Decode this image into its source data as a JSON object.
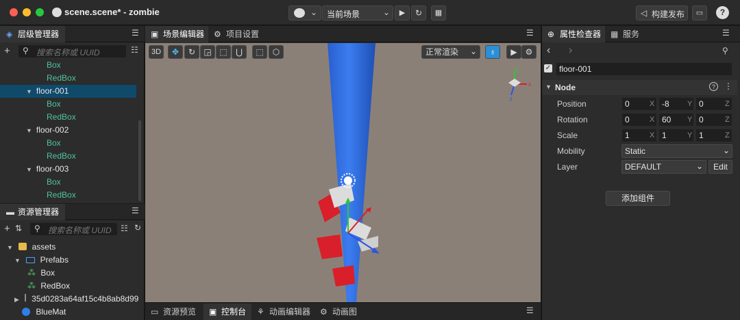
{
  "window": {
    "title": "scene.scene* - zombie"
  },
  "toolbar": {
    "scene_select": "当前场景",
    "build_label": "构建发布"
  },
  "hierarchy": {
    "tab": "层级管理器",
    "search_placeholder": "搜索名称或 UUID",
    "rows": [
      {
        "label": "Box",
        "kind": "child"
      },
      {
        "label": "RedBox",
        "kind": "child"
      },
      {
        "label": "floor-001",
        "kind": "parent",
        "selected": true
      },
      {
        "label": "Box",
        "kind": "child"
      },
      {
        "label": "RedBox",
        "kind": "child"
      },
      {
        "label": "floor-002",
        "kind": "parent"
      },
      {
        "label": "Box",
        "kind": "child"
      },
      {
        "label": "RedBox",
        "kind": "child"
      },
      {
        "label": "floor-003",
        "kind": "parent"
      },
      {
        "label": "Box",
        "kind": "child"
      },
      {
        "label": "RedBox",
        "kind": "child"
      }
    ]
  },
  "assets": {
    "tab": "资源管理器",
    "search_placeholder": "搜索名称或 UUID",
    "root": "assets",
    "prefabs": "Prefabs",
    "box": "Box",
    "redbox": "RedBox",
    "uuid_item": "35d0283a64af15c4b8ab8d99",
    "bluemat": "BlueMat"
  },
  "scene": {
    "tab_editor": "场景编辑器",
    "tab_settings": "项目设置",
    "mode_3d": "3D",
    "render_mode": "正常渲染"
  },
  "bottom_tabs": [
    "资源预览",
    "控制台",
    "动画编辑器",
    "动画图"
  ],
  "inspector": {
    "tab": "属性检查器",
    "tab_service": "服务",
    "node_name": "floor-001",
    "section": "Node",
    "position": {
      "label": "Position",
      "x": "0",
      "y": "-8",
      "z": "0"
    },
    "rotation": {
      "label": "Rotation",
      "x": "0",
      "y": "60",
      "z": "0"
    },
    "scale": {
      "label": "Scale",
      "x": "1",
      "y": "1",
      "z": "1"
    },
    "mobility": {
      "label": "Mobility",
      "value": "Static"
    },
    "layer": {
      "label": "Layer",
      "value": "DEFAULT",
      "edit": "Edit"
    },
    "add_component": "添加组件",
    "axis_x": "X",
    "axis_y": "Y",
    "axis_z": "Z"
  }
}
